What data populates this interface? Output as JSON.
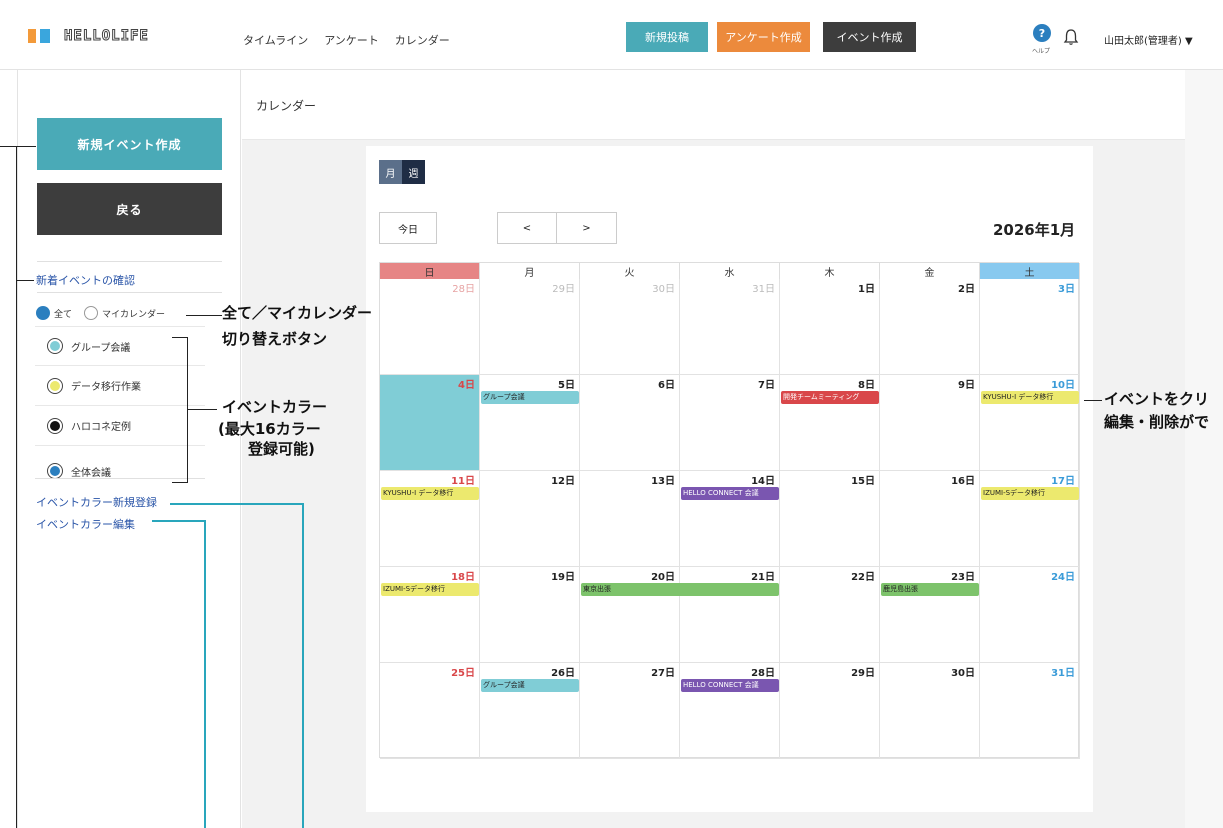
{
  "header": {
    "logo_text": "HELLOLIFE",
    "nav": [
      "タイムライン",
      "アンケート",
      "カレンダー"
    ],
    "btn_new_post": "新規投稿",
    "btn_survey": "アンケート作成",
    "btn_event": "イベント作成",
    "help_label": "ヘルプ",
    "user": "山田太郎(管理者) ▼"
  },
  "sidebar": {
    "new_event": "新規イベント作成",
    "back": "戻る",
    "check_new": "新着イベントの確認",
    "radio_all": "全て",
    "radio_my": "マイカレンダー",
    "colors": [
      {
        "label": "グループ会議",
        "color": "#80cdd6"
      },
      {
        "label": "データ移行作業",
        "color": "#ece96e"
      },
      {
        "label": "ハロコネ定例",
        "color": "#111111"
      },
      {
        "label": "全体会議",
        "color": "#2b7fbf"
      }
    ],
    "color_new": "イベントカラー新規登録",
    "color_edit": "イベントカラー編集"
  },
  "main": {
    "breadcrumb": "カレンダー",
    "view_month": "月",
    "view_week": "週",
    "today": "今日",
    "prev": "<",
    "next": ">",
    "month_title": "2026年1月",
    "weekdays": [
      "日",
      "月",
      "火",
      "水",
      "木",
      "金",
      "土"
    ],
    "weeks": [
      [
        "28日",
        "29日",
        "30日",
        "31日",
        "1日",
        "2日",
        "3日"
      ],
      [
        "4日",
        "5日",
        "6日",
        "7日",
        "8日",
        "9日",
        "10日"
      ],
      [
        "11日",
        "12日",
        "13日",
        "14日",
        "15日",
        "16日",
        "17日"
      ],
      [
        "18日",
        "19日",
        "20日",
        "21日",
        "22日",
        "23日",
        "24日"
      ],
      [
        "25日",
        "26日",
        "27日",
        "28日",
        "29日",
        "30日",
        "31日"
      ]
    ],
    "events": [
      {
        "week": 1,
        "col": 1,
        "span": 1,
        "label": "グループ会議",
        "color": "#80cdd6"
      },
      {
        "week": 1,
        "col": 4,
        "span": 1,
        "label": "開発チームミーティング",
        "color": "#d9474a"
      },
      {
        "week": 1,
        "col": 6,
        "span": 1,
        "label": "KYUSHU-I データ移行",
        "color": "#ece96e"
      },
      {
        "week": 2,
        "col": 0,
        "span": 1,
        "label": "KYUSHU-I データ移行",
        "color": "#ece96e"
      },
      {
        "week": 2,
        "col": 3,
        "span": 1,
        "label": "HELLO CONNECT 会議",
        "color": "#7a56b0"
      },
      {
        "week": 2,
        "col": 6,
        "span": 1,
        "label": "IZUMI-Sデータ移行",
        "color": "#ece96e"
      },
      {
        "week": 3,
        "col": 0,
        "span": 1,
        "label": "IZUMI-Sデータ移行",
        "color": "#ece96e"
      },
      {
        "week": 3,
        "col": 2,
        "span": 2,
        "label": "東京出張",
        "color": "#7dc36b"
      },
      {
        "week": 3,
        "col": 5,
        "span": 1,
        "label": "鹿児島出張",
        "color": "#7dc36b"
      },
      {
        "week": 4,
        "col": 1,
        "span": 1,
        "label": "グループ会議",
        "color": "#80cdd6"
      },
      {
        "week": 4,
        "col": 3,
        "span": 1,
        "label": "HELLO CONNECT 会議",
        "color": "#7a56b0"
      }
    ]
  },
  "annotations": {
    "toggle_1": "全て／マイカレンダー",
    "toggle_2": "切り替えボタン",
    "color_1": "イベントカラー",
    "color_2": "(最大16カラー",
    "color_3": "登録可能)",
    "click_1": "イベントをクリ",
    "click_2": "編集・削除がで"
  },
  "colors": {
    "teal": "#4aaab7",
    "orange": "#ec8a3c",
    "dark": "#3d3d3d",
    "sunday_head": "#e68585",
    "saturday_head": "#88c9ef",
    "sunday_text": "#d9474a",
    "saturday_text": "#3a9bd8",
    "today_bg": "#80cdd6"
  }
}
